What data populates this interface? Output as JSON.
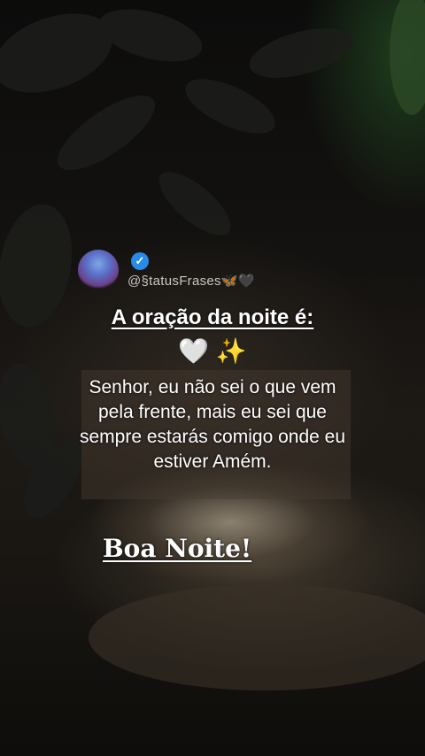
{
  "post": {
    "handle": "@§tatusFrases🦋🖤",
    "verified_icon": "verified-badge-icon",
    "title": "A oração da noite é:",
    "emoji_heart": "🤍",
    "emoji_sparkles": "✨",
    "prayer": "Senhor, eu não sei o que vem pela frente, mais eu sei que sempre estarás comigo onde eu estiver Amém.",
    "closing": "Boa Noite!"
  },
  "colors": {
    "verified": "#2a8ae8",
    "text": "#ffffff",
    "handle": "#c9c6c2"
  }
}
